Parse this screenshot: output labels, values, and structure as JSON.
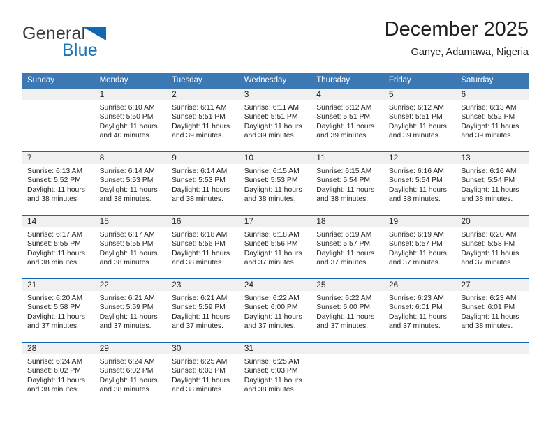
{
  "brand": {
    "name_part1": "General",
    "name_part2": "Blue",
    "logo_icon": "triangle-flag-icon"
  },
  "header": {
    "title": "December 2025",
    "location": "Ganye, Adamawa, Nigeria"
  },
  "calendar": {
    "weekday_headers": [
      "Sunday",
      "Monday",
      "Tuesday",
      "Wednesday",
      "Thursday",
      "Friday",
      "Saturday"
    ],
    "header_bg_color": "#3c78b4",
    "row_divider_color": "#1268b3",
    "daynum_bg_color": "#f0f0f0",
    "weeks": [
      [
        {
          "day": "",
          "sunrise": "",
          "sunset": "",
          "daylight_line1": "",
          "daylight_line2": ""
        },
        {
          "day": "1",
          "sunrise": "Sunrise: 6:10 AM",
          "sunset": "Sunset: 5:50 PM",
          "daylight_line1": "Daylight: 11 hours",
          "daylight_line2": "and 40 minutes."
        },
        {
          "day": "2",
          "sunrise": "Sunrise: 6:11 AM",
          "sunset": "Sunset: 5:51 PM",
          "daylight_line1": "Daylight: 11 hours",
          "daylight_line2": "and 39 minutes."
        },
        {
          "day": "3",
          "sunrise": "Sunrise: 6:11 AM",
          "sunset": "Sunset: 5:51 PM",
          "daylight_line1": "Daylight: 11 hours",
          "daylight_line2": "and 39 minutes."
        },
        {
          "day": "4",
          "sunrise": "Sunrise: 6:12 AM",
          "sunset": "Sunset: 5:51 PM",
          "daylight_line1": "Daylight: 11 hours",
          "daylight_line2": "and 39 minutes."
        },
        {
          "day": "5",
          "sunrise": "Sunrise: 6:12 AM",
          "sunset": "Sunset: 5:51 PM",
          "daylight_line1": "Daylight: 11 hours",
          "daylight_line2": "and 39 minutes."
        },
        {
          "day": "6",
          "sunrise": "Sunrise: 6:13 AM",
          "sunset": "Sunset: 5:52 PM",
          "daylight_line1": "Daylight: 11 hours",
          "daylight_line2": "and 39 minutes."
        }
      ],
      [
        {
          "day": "7",
          "sunrise": "Sunrise: 6:13 AM",
          "sunset": "Sunset: 5:52 PM",
          "daylight_line1": "Daylight: 11 hours",
          "daylight_line2": "and 38 minutes."
        },
        {
          "day": "8",
          "sunrise": "Sunrise: 6:14 AM",
          "sunset": "Sunset: 5:53 PM",
          "daylight_line1": "Daylight: 11 hours",
          "daylight_line2": "and 38 minutes."
        },
        {
          "day": "9",
          "sunrise": "Sunrise: 6:14 AM",
          "sunset": "Sunset: 5:53 PM",
          "daylight_line1": "Daylight: 11 hours",
          "daylight_line2": "and 38 minutes."
        },
        {
          "day": "10",
          "sunrise": "Sunrise: 6:15 AM",
          "sunset": "Sunset: 5:53 PM",
          "daylight_line1": "Daylight: 11 hours",
          "daylight_line2": "and 38 minutes."
        },
        {
          "day": "11",
          "sunrise": "Sunrise: 6:15 AM",
          "sunset": "Sunset: 5:54 PM",
          "daylight_line1": "Daylight: 11 hours",
          "daylight_line2": "and 38 minutes."
        },
        {
          "day": "12",
          "sunrise": "Sunrise: 6:16 AM",
          "sunset": "Sunset: 5:54 PM",
          "daylight_line1": "Daylight: 11 hours",
          "daylight_line2": "and 38 minutes."
        },
        {
          "day": "13",
          "sunrise": "Sunrise: 6:16 AM",
          "sunset": "Sunset: 5:54 PM",
          "daylight_line1": "Daylight: 11 hours",
          "daylight_line2": "and 38 minutes."
        }
      ],
      [
        {
          "day": "14",
          "sunrise": "Sunrise: 6:17 AM",
          "sunset": "Sunset: 5:55 PM",
          "daylight_line1": "Daylight: 11 hours",
          "daylight_line2": "and 38 minutes."
        },
        {
          "day": "15",
          "sunrise": "Sunrise: 6:17 AM",
          "sunset": "Sunset: 5:55 PM",
          "daylight_line1": "Daylight: 11 hours",
          "daylight_line2": "and 38 minutes."
        },
        {
          "day": "16",
          "sunrise": "Sunrise: 6:18 AM",
          "sunset": "Sunset: 5:56 PM",
          "daylight_line1": "Daylight: 11 hours",
          "daylight_line2": "and 38 minutes."
        },
        {
          "day": "17",
          "sunrise": "Sunrise: 6:18 AM",
          "sunset": "Sunset: 5:56 PM",
          "daylight_line1": "Daylight: 11 hours",
          "daylight_line2": "and 37 minutes."
        },
        {
          "day": "18",
          "sunrise": "Sunrise: 6:19 AM",
          "sunset": "Sunset: 5:57 PM",
          "daylight_line1": "Daylight: 11 hours",
          "daylight_line2": "and 37 minutes."
        },
        {
          "day": "19",
          "sunrise": "Sunrise: 6:19 AM",
          "sunset": "Sunset: 5:57 PM",
          "daylight_line1": "Daylight: 11 hours",
          "daylight_line2": "and 37 minutes."
        },
        {
          "day": "20",
          "sunrise": "Sunrise: 6:20 AM",
          "sunset": "Sunset: 5:58 PM",
          "daylight_line1": "Daylight: 11 hours",
          "daylight_line2": "and 37 minutes."
        }
      ],
      [
        {
          "day": "21",
          "sunrise": "Sunrise: 6:20 AM",
          "sunset": "Sunset: 5:58 PM",
          "daylight_line1": "Daylight: 11 hours",
          "daylight_line2": "and 37 minutes."
        },
        {
          "day": "22",
          "sunrise": "Sunrise: 6:21 AM",
          "sunset": "Sunset: 5:59 PM",
          "daylight_line1": "Daylight: 11 hours",
          "daylight_line2": "and 37 minutes."
        },
        {
          "day": "23",
          "sunrise": "Sunrise: 6:21 AM",
          "sunset": "Sunset: 5:59 PM",
          "daylight_line1": "Daylight: 11 hours",
          "daylight_line2": "and 37 minutes."
        },
        {
          "day": "24",
          "sunrise": "Sunrise: 6:22 AM",
          "sunset": "Sunset: 6:00 PM",
          "daylight_line1": "Daylight: 11 hours",
          "daylight_line2": "and 37 minutes."
        },
        {
          "day": "25",
          "sunrise": "Sunrise: 6:22 AM",
          "sunset": "Sunset: 6:00 PM",
          "daylight_line1": "Daylight: 11 hours",
          "daylight_line2": "and 37 minutes."
        },
        {
          "day": "26",
          "sunrise": "Sunrise: 6:23 AM",
          "sunset": "Sunset: 6:01 PM",
          "daylight_line1": "Daylight: 11 hours",
          "daylight_line2": "and 37 minutes."
        },
        {
          "day": "27",
          "sunrise": "Sunrise: 6:23 AM",
          "sunset": "Sunset: 6:01 PM",
          "daylight_line1": "Daylight: 11 hours",
          "daylight_line2": "and 38 minutes."
        }
      ],
      [
        {
          "day": "28",
          "sunrise": "Sunrise: 6:24 AM",
          "sunset": "Sunset: 6:02 PM",
          "daylight_line1": "Daylight: 11 hours",
          "daylight_line2": "and 38 minutes."
        },
        {
          "day": "29",
          "sunrise": "Sunrise: 6:24 AM",
          "sunset": "Sunset: 6:02 PM",
          "daylight_line1": "Daylight: 11 hours",
          "daylight_line2": "and 38 minutes."
        },
        {
          "day": "30",
          "sunrise": "Sunrise: 6:25 AM",
          "sunset": "Sunset: 6:03 PM",
          "daylight_line1": "Daylight: 11 hours",
          "daylight_line2": "and 38 minutes."
        },
        {
          "day": "31",
          "sunrise": "Sunrise: 6:25 AM",
          "sunset": "Sunset: 6:03 PM",
          "daylight_line1": "Daylight: 11 hours",
          "daylight_line2": "and 38 minutes."
        },
        {
          "day": "",
          "sunrise": "",
          "sunset": "",
          "daylight_line1": "",
          "daylight_line2": ""
        },
        {
          "day": "",
          "sunrise": "",
          "sunset": "",
          "daylight_line1": "",
          "daylight_line2": ""
        },
        {
          "day": "",
          "sunrise": "",
          "sunset": "",
          "daylight_line1": "",
          "daylight_line2": ""
        }
      ]
    ]
  }
}
